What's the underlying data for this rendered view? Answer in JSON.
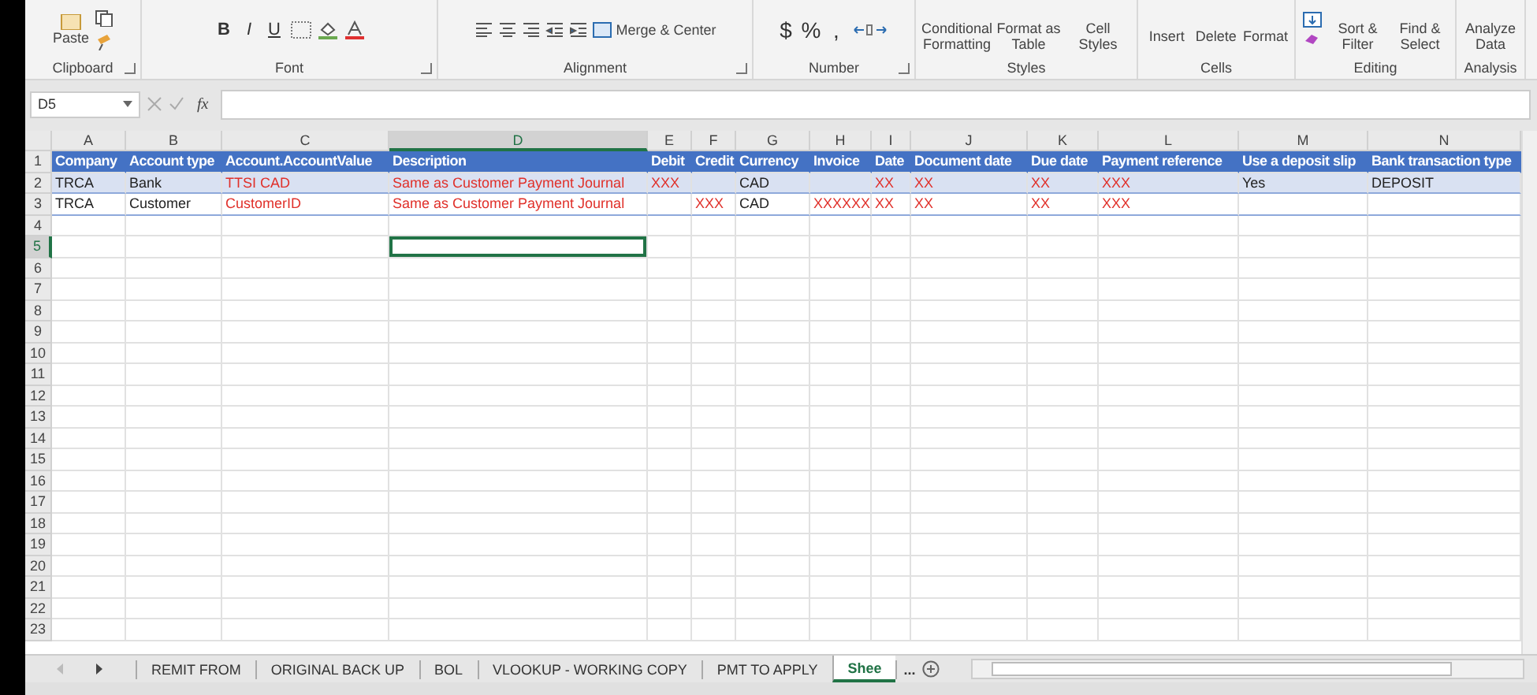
{
  "ribbon": {
    "groups": [
      {
        "label": "Clipboard",
        "launcher": true,
        "buttons": [
          {
            "label": "Paste",
            "kind": "paste"
          }
        ]
      },
      {
        "label": "Font",
        "launcher": true,
        "buttons": [
          {
            "label": "B",
            "kind": "bold"
          },
          {
            "label": "I",
            "kind": "italic"
          },
          {
            "label": "U",
            "kind": "underline"
          },
          {
            "kind": "borders"
          },
          {
            "kind": "fill"
          },
          {
            "kind": "fontcolor"
          }
        ]
      },
      {
        "label": "Alignment",
        "launcher": true,
        "buttons": [
          {
            "kind": "alignleft"
          },
          {
            "kind": "aligncenter"
          },
          {
            "kind": "alignright"
          },
          {
            "kind": "outdent"
          },
          {
            "kind": "indent"
          },
          {
            "label": "Merge & Center",
            "kind": "merge"
          }
        ]
      },
      {
        "label": "Number",
        "launcher": true,
        "buttons": [
          {
            "label": "$",
            "kind": "symbol"
          },
          {
            "label": "%",
            "kind": "symbol"
          },
          {
            "label": ",",
            "kind": "symbol"
          },
          {
            "kind": "decimals"
          }
        ]
      },
      {
        "label": "Styles",
        "launcher": false,
        "buttons": [
          {
            "label": "Conditional Formatting",
            "kind": "big"
          },
          {
            "label": "Format as Table",
            "kind": "big"
          },
          {
            "label": "Cell Styles",
            "kind": "big"
          }
        ]
      },
      {
        "label": "Cells",
        "launcher": false,
        "buttons": [
          {
            "label": "Insert",
            "kind": "big"
          },
          {
            "label": "Delete",
            "kind": "big"
          },
          {
            "label": "Format",
            "kind": "big"
          }
        ]
      },
      {
        "label": "Editing",
        "launcher": false,
        "buttons": [
          {
            "kind": "fillicon"
          },
          {
            "label": "Sort & Filter",
            "kind": "big"
          },
          {
            "label": "Find & Select",
            "kind": "big"
          }
        ]
      },
      {
        "label": "Analysis",
        "launcher": false,
        "buttons": [
          {
            "label": "Analyze Data",
            "kind": "plain"
          }
        ]
      }
    ]
  },
  "formula_bar": {
    "name_box": "D5",
    "function_label": "fx"
  },
  "sheet": {
    "columns": [
      {
        "label": "A",
        "selected": false
      },
      {
        "label": "B",
        "selected": false
      },
      {
        "label": "C",
        "selected": false
      },
      {
        "label": "D",
        "selected": true
      },
      {
        "label": "E",
        "selected": false
      },
      {
        "label": "F",
        "selected": false
      },
      {
        "label": "G",
        "selected": false
      },
      {
        "label": "H",
        "selected": false
      },
      {
        "label": "I",
        "selected": false
      },
      {
        "label": "J",
        "selected": false
      },
      {
        "label": "K",
        "selected": false
      },
      {
        "label": "L",
        "selected": false
      },
      {
        "label": "M",
        "selected": false
      },
      {
        "label": "N",
        "selected": false
      }
    ],
    "rows": [
      {
        "number": "1",
        "kind": "header",
        "selected": false,
        "cells": [
          {
            "text": "Company"
          },
          {
            "text": "Account type"
          },
          {
            "text": "Account.AccountValue"
          },
          {
            "text": "Description"
          },
          {
            "text": "Debit"
          },
          {
            "text": "Credit"
          },
          {
            "text": "Currency"
          },
          {
            "text": "Invoice"
          },
          {
            "text": "Date"
          },
          {
            "text": "Document date"
          },
          {
            "text": "Due date"
          },
          {
            "text": "Payment reference"
          },
          {
            "text": "Use a deposit slip"
          },
          {
            "text": "Bank transaction type"
          }
        ]
      },
      {
        "number": "2",
        "kind": "band",
        "selected": false,
        "cells": [
          {
            "text": "TRCA",
            "kind": "plain"
          },
          {
            "text": "Bank",
            "kind": "plain"
          },
          {
            "text": "TTSI CAD",
            "kind": "red"
          },
          {
            "text": "Same as Customer Payment Journal",
            "kind": "red"
          },
          {
            "text": "XXX",
            "kind": "red"
          },
          {},
          {
            "text": "CAD",
            "kind": "plain"
          },
          {},
          {
            "text": "XX",
            "kind": "red"
          },
          {
            "text": "XX",
            "kind": "red"
          },
          {
            "text": "XX",
            "kind": "red"
          },
          {
            "text": "XXX",
            "kind": "red"
          },
          {
            "text": "Yes",
            "kind": "plain"
          },
          {
            "text": "DEPOSIT",
            "kind": "plain"
          }
        ]
      },
      {
        "number": "3",
        "kind": "data",
        "selected": false,
        "cells": [
          {
            "text": "TRCA",
            "kind": "plain"
          },
          {
            "text": "Customer",
            "kind": "plain"
          },
          {
            "text": "CustomerID",
            "kind": "red"
          },
          {
            "text": "Same as Customer Payment Journal",
            "kind": "red"
          },
          {},
          {
            "text": "XXX",
            "kind": "red"
          },
          {
            "text": "CAD",
            "kind": "plain"
          },
          {
            "text": "XXXXXX",
            "kind": "red"
          },
          {
            "text": "XX",
            "kind": "red"
          },
          {
            "text": "XX",
            "kind": "red"
          },
          {
            "text": "XX",
            "kind": "red"
          },
          {
            "text": "XXX",
            "kind": "red"
          },
          {},
          {}
        ]
      },
      {
        "number": "4",
        "kind": "empty",
        "selected": false
      },
      {
        "number": "5",
        "kind": "empty",
        "selected": true
      },
      {
        "number": "6",
        "kind": "empty",
        "selected": false
      },
      {
        "number": "7",
        "kind": "empty",
        "selected": false
      },
      {
        "number": "8",
        "kind": "empty",
        "selected": false
      },
      {
        "number": "9",
        "kind": "empty",
        "selected": false
      },
      {
        "number": "10",
        "kind": "empty",
        "selected": false
      },
      {
        "number": "11",
        "kind": "empty",
        "selected": false
      },
      {
        "number": "12",
        "kind": "empty",
        "selected": false
      },
      {
        "number": "13",
        "kind": "empty",
        "selected": false
      },
      {
        "number": "14",
        "kind": "empty",
        "selected": false
      },
      {
        "number": "15",
        "kind": "empty",
        "selected": false
      },
      {
        "number": "16",
        "kind": "empty",
        "selected": false
      },
      {
        "number": "17",
        "kind": "empty",
        "selected": false
      },
      {
        "number": "18",
        "kind": "empty",
        "selected": false
      },
      {
        "number": "19",
        "kind": "empty",
        "selected": false
      },
      {
        "number": "20",
        "kind": "empty",
        "selected": false
      },
      {
        "number": "21",
        "kind": "empty",
        "selected": false
      },
      {
        "number": "22",
        "kind": "empty",
        "selected": false
      },
      {
        "number": "23",
        "kind": "empty",
        "selected": false
      }
    ]
  },
  "sheet_tabs": {
    "tabs": [
      {
        "label": "REMIT FROM",
        "selected": false
      },
      {
        "label": "ORIGINAL BACK UP",
        "selected": false
      },
      {
        "label": "BOL",
        "selected": false
      },
      {
        "label": "VLOOKUP - WORKING COPY",
        "selected": false
      },
      {
        "label": "PMT TO APPLY",
        "selected": false
      },
      {
        "label": "Shee",
        "selected": true
      }
    ],
    "more": "..."
  }
}
